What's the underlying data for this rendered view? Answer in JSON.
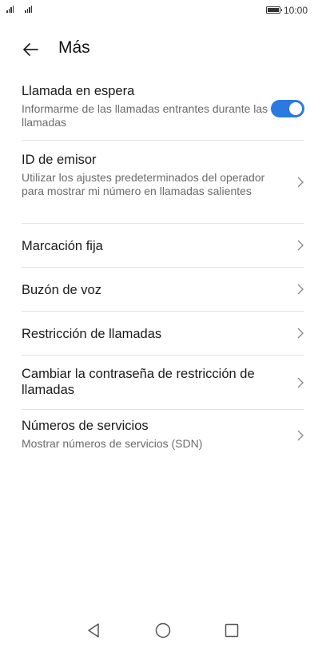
{
  "status_bar": {
    "clock": "10:00"
  },
  "header": {
    "title": "Más"
  },
  "settings": [
    {
      "title": "Llamada en espera",
      "subtitle": "Informarme de las llamadas entrantes durante las llamadas",
      "control": "toggle",
      "toggle_on": true
    },
    {
      "title": "ID de emisor",
      "subtitle": "Utilizar los ajustes predeterminados del operador para mostrar mi número en llamadas salientes",
      "control": "chevron"
    },
    {
      "title": "Marcación fija",
      "control": "chevron"
    },
    {
      "title": "Buzón de voz",
      "control": "chevron"
    },
    {
      "title": "Restricción de llamadas",
      "control": "chevron"
    },
    {
      "title": "Cambiar la contraseña de restricción de llamadas",
      "control": "chevron"
    },
    {
      "title": "Números de servicios",
      "subtitle": "Mostrar números de servicios (SDN)",
      "control": "chevron"
    }
  ],
  "colors": {
    "accent": "#2b7ae0"
  }
}
